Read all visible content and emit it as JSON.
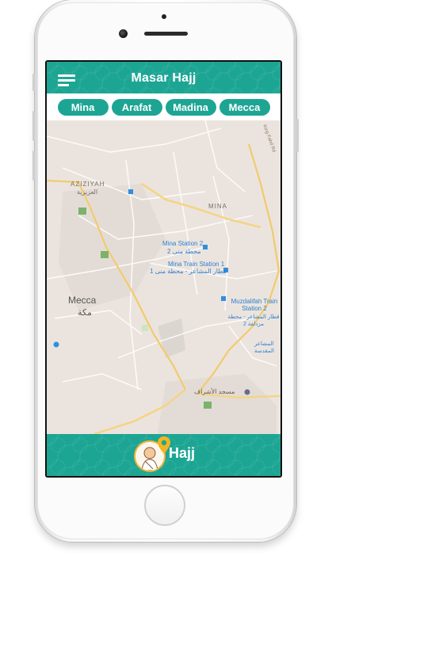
{
  "app": {
    "title": "Masar Hajj",
    "accent_color": "#1da594",
    "menu_icon": "hamburger-menu-icon"
  },
  "tabs": [
    {
      "label": "Mina"
    },
    {
      "label": "Arafat"
    },
    {
      "label": "Madina"
    },
    {
      "label": "Mecca"
    }
  ],
  "map": {
    "labels": {
      "aziziyah_en": "AZIZIYAH",
      "aziziyah_ar": "العزيزية",
      "mina": "MINA",
      "mecca_en": "Mecca",
      "mecca_ar": "مكة",
      "mina_station2_en": "Mina Station 2",
      "mina_station2_ar": "محطة منى 2",
      "mina_station1_en": "Mina Train Station 1",
      "mina_station1_ar": "قطار المشاعر - محطة منى 1",
      "muzdalifah_en": "Muzdalifah Train Station 2",
      "muzdalifah_ar": "قطار المشاعر - محطة مزدلفة 2",
      "mashaer_ar": "المشاعر المقدسة",
      "mosque_ar": "مسجد الأشراف",
      "road_kingfahd": "King Fahd Rd"
    }
  },
  "bottom": {
    "label": "Hajj",
    "avatar_icon": "pilgrim-avatar-icon",
    "pin_icon": "location-pin-icon"
  }
}
